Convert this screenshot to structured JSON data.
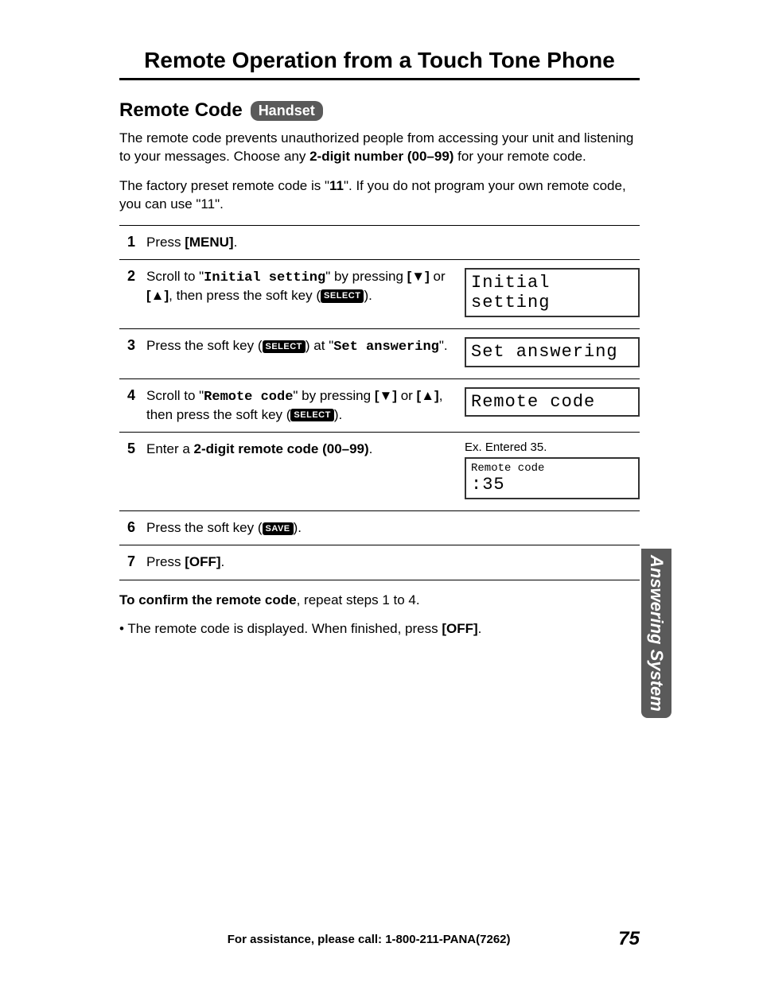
{
  "title": "Remote Operation from a Touch Tone Phone",
  "subtitle": "Remote Code",
  "badge": "Handset",
  "intro_line1a": "The remote code prevents unauthorized people from accessing your unit and listening to your messages. Choose any ",
  "intro_line1b": "2-digit number (00–99)",
  "intro_line1c": " for your remote code.",
  "intro_line2a": "The factory preset remote code is \"",
  "intro_line2b": "11",
  "intro_line2c": "\". If you do not program your own remote code, you can use \"11\".",
  "steps": {
    "s1": {
      "num": "1",
      "a": "Press ",
      "b": "[MENU]",
      "c": "."
    },
    "s2": {
      "num": "2",
      "a": "Scroll to \"",
      "b": "Initial setting",
      "c": "\" by pressing ",
      "d": "[▼]",
      "e": " or ",
      "f": "[▲]",
      "g": ", then press the soft key (",
      "key": "SELECT",
      "h": ").",
      "lcd": "Initial setting"
    },
    "s3": {
      "num": "3",
      "a": "Press the soft key (",
      "key": "SELECT",
      "b": ") at \"",
      "c": "Set answering",
      "d": "\".",
      "lcd": "Set answering"
    },
    "s4": {
      "num": "4",
      "a": "Scroll to \"",
      "b": "Remote code",
      "c": "\" by pressing ",
      "d": "[▼]",
      "e": " or ",
      "f": "[▲]",
      "g": ", then press the soft key (",
      "key": "SELECT",
      "h": ").",
      "lcd": "Remote code"
    },
    "s5": {
      "num": "5",
      "a": "Enter a ",
      "b": "2-digit remote code (00–99)",
      "c": ".",
      "ex": "Ex. Entered 35.",
      "lcd1": "Remote code",
      "lcd2": ":35"
    },
    "s6": {
      "num": "6",
      "a": "Press the soft key (",
      "key": "SAVE",
      "b": ")."
    },
    "s7": {
      "num": "7",
      "a": "Press ",
      "b": "[OFF]",
      "c": "."
    }
  },
  "confirm_a": "To confirm the remote code",
  "confirm_b": ", repeat steps 1 to 4.",
  "bullet_a": "• The remote code is displayed. When finished, press ",
  "bullet_b": "[OFF]",
  "bullet_c": ".",
  "side_tab": "Answering System",
  "footer_assist": "For assistance, please call: 1-800-211-PANA(7262)",
  "page_num": "75"
}
